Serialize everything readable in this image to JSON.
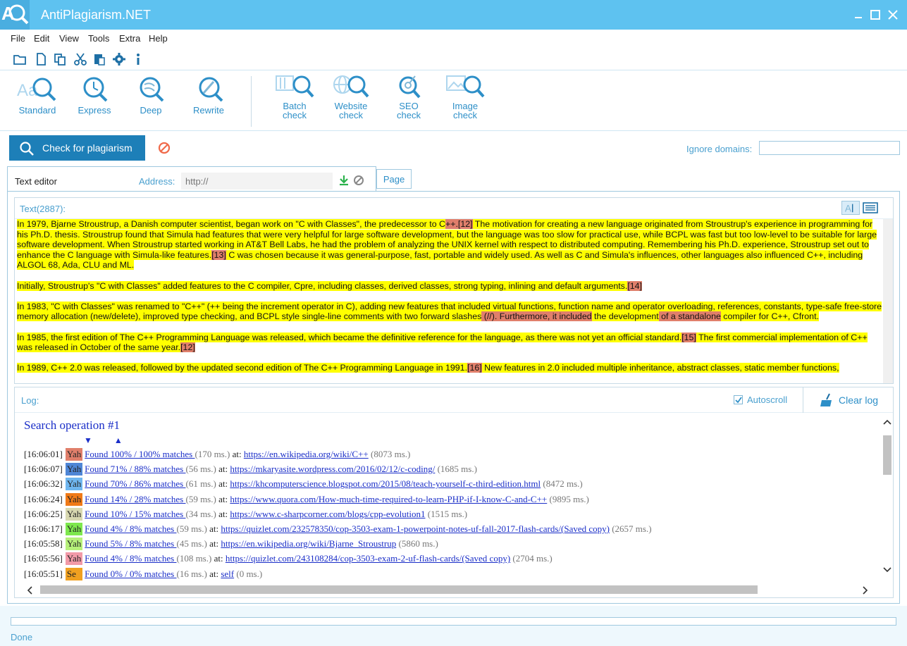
{
  "app": {
    "title": "AntiPlagiarism.NET"
  },
  "menu": [
    "File",
    "Edit",
    "View",
    "Tools",
    "Extra",
    "Help"
  ],
  "ribbon": {
    "standard": "Standard",
    "express": "Express",
    "deep": "Deep",
    "rewrite": "Rewrite",
    "batch": [
      "Batch",
      "check"
    ],
    "website": [
      "Website",
      "check"
    ],
    "seo": [
      "SEO",
      "check"
    ],
    "image": [
      "Image",
      "check"
    ]
  },
  "check_button": "Check for plagiarism",
  "ignore_domains": {
    "label": "Ignore domains:",
    "value": ""
  },
  "tabs": {
    "editor": "Text editor",
    "address_label": "Address:",
    "address_placeholder": "http://",
    "page": "Page"
  },
  "editor": {
    "count": "Text(2887):",
    "p1": [
      {
        "t": "In 1979, Bjarne Stroustrup, a Danish computer scientist, began work on \"C with Classes\", the predecessor to C",
        "c": "y"
      },
      {
        "t": "++.[12]",
        "c": "r"
      },
      {
        "t": " The motivation for creating a new language originated from Stroustrup's experience in programming for his Ph.D. thesis. Stroustrup found that Simula had features that were very helpful for large software development, but the language was too slow for practical use, while BCPL was fast but too low-level to be suitable for large software development. When Stroustrup started working in AT&T Bell Labs, he had the problem of analyzing the UNIX kernel with respect to distributed computing. Remembering his Ph.D. experience, Stroustrup set out to enhance the C language with Simula-like features.",
        "c": "y"
      },
      {
        "t": "[13]",
        "c": "r"
      },
      {
        "t": " C was chosen because it was general-purpose, fast, portable and widely used. As well as C and Simula's influences, other languages also influenced C++, including ALGOL 68, Ada, CLU and ML.",
        "c": "y"
      }
    ],
    "p2": [
      {
        "t": "Initially, Stroustrup's \"C with Classes\" added features to the C compiler, Cpre, including classes, derived classes, strong typing, inlining and default arguments.",
        "c": "y"
      },
      {
        "t": "[14]",
        "c": "r"
      }
    ],
    "p3": [
      {
        "t": "In 1983, \"C with Classes\" was renamed to \"C++\" (++ being the increment operator in C), adding new features that included virtual functions, function name and operator overloading, references, constants, type-safe free-store memory allocation (new/delete), improved type checking, and BCPL style single-line comments with two forward slashes",
        "c": "y"
      },
      {
        "t": " (//). Furthermore, it included",
        "c": "r"
      },
      {
        "t": " the development",
        "c": "y"
      },
      {
        "t": " of a standalone",
        "c": "r"
      },
      {
        "t": " compiler for C++, Cfront.",
        "c": "y"
      }
    ],
    "p4": [
      {
        "t": "In 1985, the first edition of The C++ Programming Language was released, which became the definitive reference for the language, as there was not yet an official standard.",
        "c": "y"
      },
      {
        "t": "[15]",
        "c": "r"
      },
      {
        "t": " The first commercial implementation of C++ was released in October of the same year.",
        "c": "y"
      },
      {
        "t": "[12]",
        "c": "r"
      }
    ],
    "p5": [
      {
        "t": "In 1989, C++ 2.0 was released, followed by the updated second edition of The C++ Programming Language in 1991.",
        "c": "y"
      },
      {
        "t": "[16]",
        "c": "r"
      },
      {
        "t": " New features in 2.0 included multiple inheritance, abstract classes, static member functions,",
        "c": "y"
      }
    ]
  },
  "log": {
    "label": "Log:",
    "autoscroll": "Autoscroll",
    "clear": "Clear log",
    "operation": "Search operation #1",
    "arrows": "▼ ▲",
    "entries": [
      {
        "time": "[16:06:01]",
        "engine": "Yah",
        "color": "#e07f6b",
        "found": "Found 100% / 100% matches ",
        "ms": "(170 ms.)",
        "url": "https://en.wikipedia.org/wiki/C++",
        "tail": "(8073 ms.)"
      },
      {
        "time": "[16:06:07]",
        "engine": "Yah",
        "color": "#4f86d6",
        "found": "Found 71% / 88% matches ",
        "ms": "(56 ms.)",
        "url": "https://mkaryasite.wordpress.com/2016/02/12/c-coding/",
        "tail": "(1685 ms.)"
      },
      {
        "time": "[16:06:32]",
        "engine": "Yah",
        "color": "#6fb6ef",
        "found": "Found 70% / 86% matches ",
        "ms": "(61 ms.)",
        "url": "https://khcomputerscience.blogspot.com/2015/08/teach-yourself-c-third-edition.html",
        "tail": "(8472 ms.)"
      },
      {
        "time": "[16:06:24]",
        "engine": "Yah",
        "color": "#f07a18",
        "found": "Found 14% / 28% matches ",
        "ms": "(59 ms.)",
        "url": "https://www.quora.com/How-much-time-required-to-learn-PHP-if-I-know-C-and-C++",
        "tail": "(9895 ms.)"
      },
      {
        "time": "[16:06:25]",
        "engine": "Yah",
        "color": "#d8d8b0",
        "found": "Found 10% / 15% matches ",
        "ms": "(34 ms.)",
        "url": "https://www.c-sharpcorner.com/blogs/cpp-evolution1",
        "tail": "(1515 ms.)"
      },
      {
        "time": "[16:06:17]",
        "engine": "Yah",
        "color": "#7ee84e",
        "found": "Found 4% / 8% matches ",
        "ms": "(59 ms.)",
        "url": "https://quizlet.com/232578350/cop-3503-exam-1-powerpoint-notes-uf-fall-2017-flash-cards/(Saved copy)",
        "tail": "(2657 ms.)"
      },
      {
        "time": "[16:05:58]",
        "engine": "Yah",
        "color": "#b6f07a",
        "found": "Found 5% / 8% matches ",
        "ms": "(45 ms.)",
        "url": "https://en.wikipedia.org/wiki/Bjarne_Stroustrup",
        "tail": "(5860 ms.)"
      },
      {
        "time": "[16:05:56]",
        "engine": "Yah",
        "color": "#f29aa8",
        "found": "Found 4% / 8% matches ",
        "ms": "(108 ms.)",
        "url": "https://quizlet.com/243108284/cop-3503-exam-2-uf-flash-cards/(Saved copy)",
        "tail": "(2704 ms.)"
      },
      {
        "time": "[16:05:51]",
        "engine": "Se",
        "color": "#f0a020",
        "found": "Found 0% / 0% matches ",
        "ms": "(16 ms.)",
        "url": "self",
        "tail": "(0 ms.)"
      }
    ]
  },
  "status": "Done",
  "colors": {
    "accent": "#5ec2f0",
    "button": "#1d7fb8",
    "highlight": "#ffff00",
    "match": "#e07f6b"
  }
}
